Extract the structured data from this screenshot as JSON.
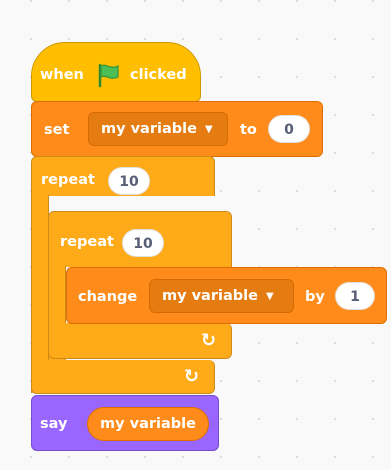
{
  "blocks": {
    "when_flag": {
      "label_when": "when",
      "label_clicked": "clicked",
      "flag_icon": "green-flag-icon",
      "color": "#ffbf00"
    },
    "set": {
      "label": "set",
      "variable": "my variable",
      "label_to": "to",
      "value": "0",
      "color": "#ff8c1a"
    },
    "repeat_outer": {
      "label": "repeat",
      "count": "10",
      "color": "#ffab19"
    },
    "repeat_inner": {
      "label": "repeat",
      "count": "10"
    },
    "change": {
      "label": "change",
      "variable": "my variable",
      "label_by": "by",
      "value": "1"
    },
    "say": {
      "label": "say",
      "reporter": "my variable",
      "color": "#9966ff"
    },
    "loop_arrow_icon": "loop-arrow-icon"
  }
}
